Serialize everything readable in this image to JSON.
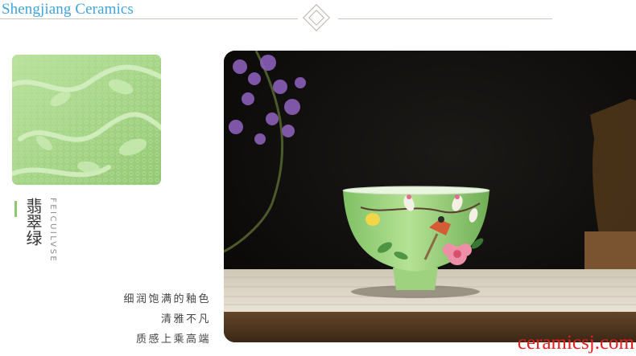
{
  "header": {
    "brand": "Shengjiang Ceramics"
  },
  "title": {
    "cn": "翡翠绿",
    "en": "FEICUILVSE"
  },
  "description": {
    "line1": "细润饱满的釉色",
    "line2": "清雅不凡",
    "line3": "质感上乘高端"
  },
  "watermark": "ceramicsj.com",
  "colors": {
    "brand": "#3fa4dc",
    "accent_green": "#8fc66f",
    "watermark": "#e31f1f"
  }
}
